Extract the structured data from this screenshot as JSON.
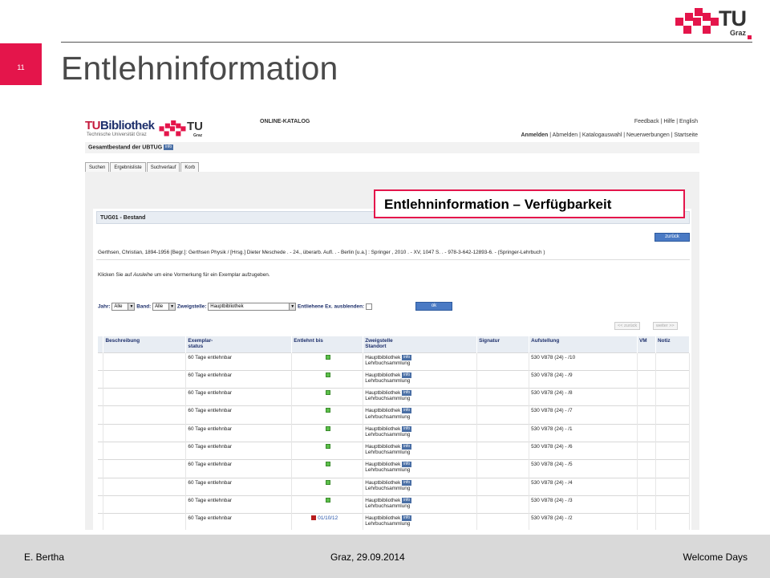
{
  "slide": {
    "number": "11",
    "title": "Entlehninformation",
    "logo_tu": "TU",
    "logo_graz": "Graz"
  },
  "highlight": "Entlehninformation – Verfügbarkeit",
  "catalog": {
    "logo_tu": "TU",
    "logo_bib": "Bibliothek",
    "logo_sub": "Technische Universität Graz",
    "online_katalog": "ONLINE-KATALOG",
    "toplinks": "Feedback | Hilfe | English",
    "toplinks2_first": "Anmelden",
    "toplinks2_rest": " | Abmelden | Katalogauswahl | Neuerwerbungen | Startseite",
    "gesamtbestand": "Gesamtbestand der UBTUG",
    "info_label": "info",
    "tabs": [
      "Suchen",
      "Ergebnisliste",
      "Suchverlauf",
      "Korb"
    ],
    "bestand_title": "TUG01 - Bestand",
    "zurueck_label": "zurück",
    "citation": "Gerthsen, Christian, 1894-1956 [Begr.]: Gerthsen Physik  / [Hrsg.] Dieter Meschede . - 24., überarb. Aufl. . - Berlin [u.a.]  : Springer , 2010 . - XV, 1047 S. . - 978-3-642-12893-6. - (Springer-Lehrbuch )",
    "instruction_pre": "Klicken Sie auf ",
    "instruction_em": "Ausleihe",
    "instruction_post": " um eine Vormerkung für ein Exemplar aufzugeben.",
    "filters": {
      "jahr_label": "Jahr:",
      "jahr_value": "Alle",
      "band_label": "Band:",
      "band_value": "Alle",
      "zweigstelle_label": "Zweigstelle:",
      "zweigstelle_value": "Hauptbibliothek",
      "entliehene_label": "Entliehene Ex. ausblenden:",
      "ok_label": "ok"
    },
    "pager_prev": "<< zurück",
    "pager_next": "weiter >>",
    "columns": [
      "Beschreibung",
      "Exemplar-status",
      "Entlehnt bis",
      "Zweigstelle Standort",
      "Signatur",
      "Aufstellung",
      "VM",
      "Notiz"
    ],
    "column_lines": {
      "exemplar_1": "Exemplar-",
      "exemplar_2": "status",
      "zweig_1": "Zweigstelle",
      "zweig_2": "Standort"
    },
    "rows": [
      {
        "status": "60 Tage entlehnbar",
        "lent": "",
        "branch": "Hauptbibliothek",
        "location": "Lehrbuchsammlung",
        "shelf": "530 V878 (24) - /10"
      },
      {
        "status": "60 Tage entlehnbar",
        "lent": "",
        "branch": "Hauptbibliothek",
        "location": "Lehrbuchsammlung",
        "shelf": "530 V878 (24) - /9"
      },
      {
        "status": "60 Tage entlehnbar",
        "lent": "",
        "branch": "Hauptbibliothek",
        "location": "Lehrbuchsammlung",
        "shelf": "530 V878 (24) - /8"
      },
      {
        "status": "60 Tage entlehnbar",
        "lent": "",
        "branch": "Hauptbibliothek",
        "location": "Lehrbuchsammlung",
        "shelf": "530 V878 (24) - /7"
      },
      {
        "status": "60 Tage entlehnbar",
        "lent": "",
        "branch": "Hauptbibliothek",
        "location": "Lehrbuchsammlung",
        "shelf": "530 V878 (24) - /1"
      },
      {
        "status": "60 Tage entlehnbar",
        "lent": "",
        "branch": "Hauptbibliothek",
        "location": "Lehrbuchsammlung",
        "shelf": "530 V878 (24) - /6"
      },
      {
        "status": "60 Tage entlehnbar",
        "lent": "",
        "branch": "Hauptbibliothek",
        "location": "Lehrbuchsammlung",
        "shelf": "530 V878 (24) - /5"
      },
      {
        "status": "60 Tage entlehnbar",
        "lent": "",
        "branch": "Hauptbibliothek",
        "location": "Lehrbuchsammlung",
        "shelf": "530 V878 (24) - /4"
      },
      {
        "status": "60 Tage entlehnbar",
        "lent": "",
        "branch": "Hauptbibliothek",
        "location": "Lehrbuchsammlung",
        "shelf": "530 V878 (24) - /3"
      },
      {
        "status": "60 Tage entlehnbar",
        "lent": "01/10/12",
        "branch": "Hauptbibliothek",
        "location": "Lehrbuchsammlung",
        "shelf": "530 V878 (24) - /2"
      }
    ]
  },
  "footer": {
    "author": "E. Bertha",
    "place_date": "Graz, 29.09.2014",
    "event": "Welcome  Days"
  },
  "colors": {
    "accent": "#e4154b",
    "catalog_blue": "#1d2f6b",
    "available": "#5cc04a",
    "lent": "#b81d1d"
  }
}
